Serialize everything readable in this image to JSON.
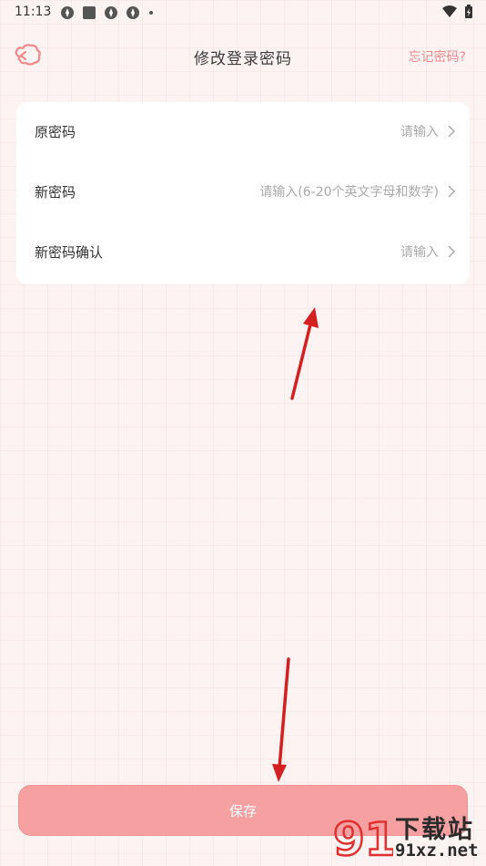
{
  "status_bar": {
    "time": "11:13"
  },
  "header": {
    "title": "修改登录密码",
    "forgot_label": "忘记密码?"
  },
  "form": {
    "rows": [
      {
        "label": "原密码",
        "placeholder": "请输入"
      },
      {
        "label": "新密码",
        "placeholder": "请输入(6-20个英文字母和数字)"
      },
      {
        "label": "新密码确认",
        "placeholder": "请输入"
      }
    ]
  },
  "save_label": "保存",
  "watermark": {
    "text": "下载站",
    "url": "91xz.net",
    "logo_text": "91"
  },
  "colors": {
    "accent": "#f08a8c",
    "button": "#f6a0a2",
    "background": "#fdf3f2",
    "arrow": "#d42020"
  }
}
